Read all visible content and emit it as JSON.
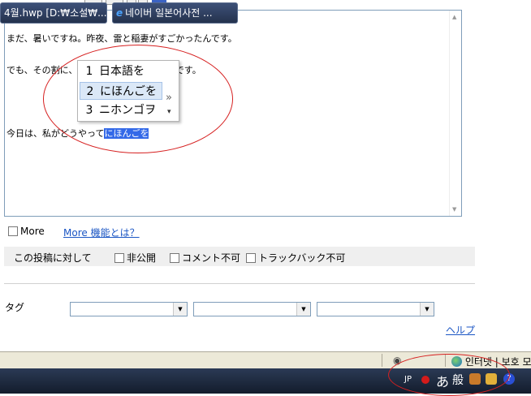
{
  "editor": {
    "lines": [
      "まだ、暑いですね。昨夜、雷と稲妻がすごかったんです。",
      "でも、その割に、雨はそう降らなかったんです。",
      "",
      "今日は、私がどうやって"
    ],
    "composing": "にほんごを"
  },
  "ime": {
    "candidates": [
      {
        "num": "1",
        "text": "日本語を"
      },
      {
        "num": "2",
        "text": "にほんごを"
      },
      {
        "num": "3",
        "text": "ニホンゴヲ"
      }
    ],
    "expand_glyph": "»",
    "dropdown_glyph": "▾"
  },
  "more": {
    "label": "More",
    "link": "More 機能とは？"
  },
  "post": {
    "label": "この投稿に対して",
    "options": [
      "非公開",
      "コメント不可",
      "トラックバック不可"
    ]
  },
  "tag": {
    "label": "タグ"
  },
  "help": "ヘルプ",
  "status_bar": {
    "zone": "인터넷 | 보호 모"
  },
  "taskbar": {
    "tasks": [
      "4월.hwp [D:₩소설₩...",
      "네이버 일본어사전 ..."
    ],
    "tray": {
      "lang": "JP",
      "hiragana": "あ",
      "mode": "般"
    }
  }
}
